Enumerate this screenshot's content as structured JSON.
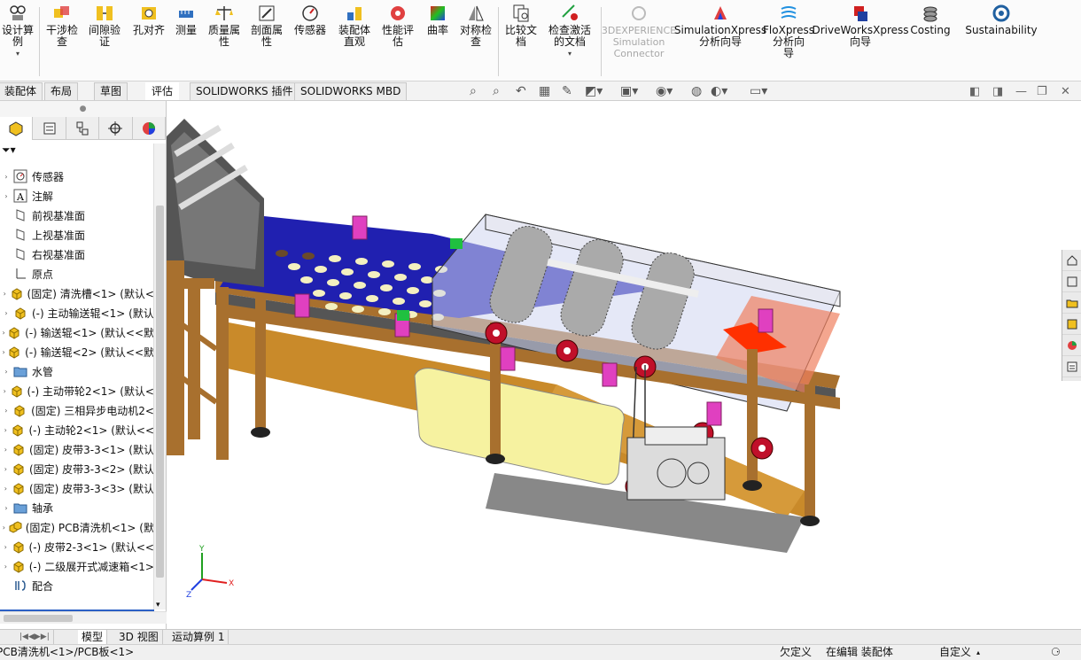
{
  "ribbon": {
    "items": [
      {
        "label": "设计算\n例",
        "icon": "design-study-icon"
      },
      {
        "label": "干涉检\n查",
        "icon": "interference-check-icon"
      },
      {
        "label": "间隙验\n证",
        "icon": "clearance-verify-icon"
      },
      {
        "label": "孔对齐",
        "icon": "hole-align-icon"
      },
      {
        "label": "测量",
        "icon": "measure-icon"
      },
      {
        "label": "质量属\n性",
        "icon": "mass-properties-icon"
      },
      {
        "label": "剖面属\n性",
        "icon": "section-properties-icon"
      },
      {
        "label": "传感器",
        "icon": "sensor-icon"
      },
      {
        "label": "装配体\n直观",
        "icon": "assembly-visualization-icon"
      },
      {
        "label": "性能评\n估",
        "icon": "performance-evaluation-icon"
      },
      {
        "label": "曲率",
        "icon": "curvature-icon"
      },
      {
        "label": "对称检\n查",
        "icon": "symmetry-check-icon"
      },
      {
        "label": "比较文\n档",
        "icon": "compare-documents-icon"
      },
      {
        "label": "检查激活\n的文档",
        "icon": "check-active-document-icon"
      },
      {
        "label": "3DEXPERIENCE\nSimulation\nConnector",
        "icon": "3dexperience-icon"
      },
      {
        "label": "SimulationXpress\n分析向导",
        "icon": "simulationxpress-icon"
      },
      {
        "label": "FloXpress\n分析向\n导",
        "icon": "floxpress-icon"
      },
      {
        "label": "DriveWorksXpress\n向导",
        "icon": "driveworksxpress-icon"
      },
      {
        "label": "Costing",
        "icon": "costing-icon"
      },
      {
        "label": "Sustainability",
        "icon": "sustainability-icon"
      }
    ]
  },
  "tabs": [
    "装配体",
    "布局",
    "草图",
    "评估",
    "SOLIDWORKS 插件",
    "SOLIDWORKS MBD"
  ],
  "active_tab": "评估",
  "tree": {
    "filter_icon": "filter-icon",
    "items": [
      {
        "label": "传感器",
        "icon": "sensor-icon",
        "type": "folder"
      },
      {
        "label": "注解",
        "icon": "annotation-icon",
        "type": "folder"
      },
      {
        "label": "前视基准面",
        "icon": "plane-icon",
        "type": "plane"
      },
      {
        "label": "上视基准面",
        "icon": "plane-icon",
        "type": "plane"
      },
      {
        "label": "右视基准面",
        "icon": "plane-icon",
        "type": "plane"
      },
      {
        "label": "原点",
        "icon": "origin-icon",
        "type": "origin"
      },
      {
        "label": "(固定) 清洗槽<1> (默认<",
        "icon": "part-icon",
        "type": "part"
      },
      {
        "label": "(-) 主动输送辊<1> (默认",
        "icon": "part-icon",
        "type": "part"
      },
      {
        "label": "(-) 输送辊<1> (默认<<默",
        "icon": "part-icon",
        "type": "part"
      },
      {
        "label": "(-) 输送辊<2> (默认<<默",
        "icon": "part-icon",
        "type": "part"
      },
      {
        "label": "水管",
        "icon": "folder-icon",
        "type": "folder"
      },
      {
        "label": "(-) 主动带轮2<1> (默认<",
        "icon": "part-icon",
        "type": "part"
      },
      {
        "label": "(固定) 三相异步电动机2<",
        "icon": "part-icon",
        "type": "part"
      },
      {
        "label": "(-) 主动轮2<1> (默认<<",
        "icon": "part-icon",
        "type": "part"
      },
      {
        "label": "(固定) 皮带3-3<1> (默认",
        "icon": "part-icon",
        "type": "part"
      },
      {
        "label": "(固定) 皮带3-3<2> (默认",
        "icon": "part-icon",
        "type": "part"
      },
      {
        "label": "(固定) 皮带3-3<3> (默认",
        "icon": "part-icon",
        "type": "part"
      },
      {
        "label": "轴承",
        "icon": "folder-icon",
        "type": "folder"
      },
      {
        "label": "(固定) PCB清洗机<1> (默",
        "icon": "subassembly-icon",
        "type": "part"
      },
      {
        "label": "(-) 皮带2-3<1> (默认<<",
        "icon": "part-icon",
        "type": "part"
      },
      {
        "label": "(-) 二级展开式减速箱<1>",
        "icon": "part-icon",
        "type": "part"
      },
      {
        "label": "配合",
        "icon": "mates-icon",
        "type": "mates"
      }
    ]
  },
  "bottom_tabs": [
    "模型",
    "3D 视图",
    "运动算例 1"
  ],
  "active_bottom_tab": "模型",
  "status": {
    "path": "PCB清洗机<1>/PCB板<1>",
    "underdefined": "欠定义",
    "editing": "在编辑 装配体",
    "custom": "自定义"
  },
  "triad": {
    "x": "X",
    "y": "Y",
    "z": "Z"
  },
  "colors": {
    "accent": "#2b60c5",
    "belt_blue": "#2020b0",
    "frame": "#a0682a",
    "red_pulley": "#c0102a",
    "pink_tab": "#e040c0"
  }
}
